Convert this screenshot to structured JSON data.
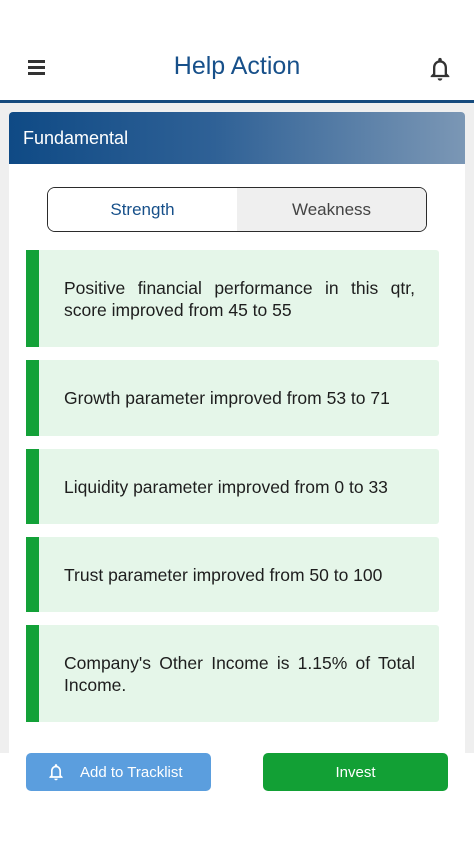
{
  "header": {
    "title": "Help Action",
    "menu_icon": "hamburger-menu-icon",
    "notification_icon": "bell-icon"
  },
  "section": {
    "title": "Fundamental"
  },
  "tabs": [
    {
      "label": "Strength",
      "active": true
    },
    {
      "label": "Weakness",
      "active": false
    }
  ],
  "items": [
    {
      "text": "Positive financial performance in this qtr, score improved from 45 to 55"
    },
    {
      "text": "Growth parameter improved from 53 to 71"
    },
    {
      "text": "Liquidity parameter improved from 0 to 33"
    },
    {
      "text": "Trust parameter improved from 50 to 100"
    },
    {
      "text": "Company's Other Income is 1.15% of Total Income."
    }
  ],
  "footer": {
    "tracklist_label": "Add to Tracklist",
    "invest_label": "Invest"
  },
  "colors": {
    "primary": "#17508a",
    "accent_green": "#13a138",
    "item_bg": "#e5f6e9",
    "tracklist_bg": "#5b9ede"
  }
}
